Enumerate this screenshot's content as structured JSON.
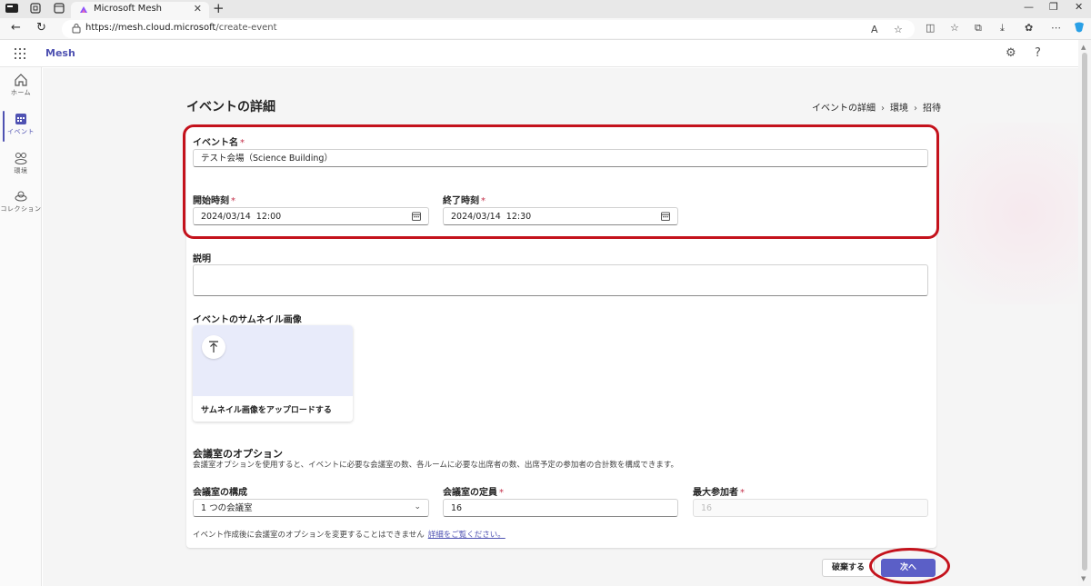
{
  "browser": {
    "tab_title": "Microsoft Mesh",
    "url_host": "https://mesh.cloud.microsoft",
    "url_path": "/create-event"
  },
  "app": {
    "name": "Mesh",
    "accent": "#5b5fc7"
  },
  "rail": {
    "items": [
      {
        "label": "ホーム",
        "icon": "home-icon"
      },
      {
        "label": "イベント",
        "icon": "calendar-icon"
      },
      {
        "label": "環境",
        "icon": "environment-icon"
      },
      {
        "label": "コレクション",
        "icon": "collection-icon"
      }
    ]
  },
  "page": {
    "title": "イベントの詳細",
    "breadcrumb": [
      "イベントの詳細",
      "環境",
      "招待"
    ]
  },
  "form": {
    "event_name_label": "イベント名",
    "event_name_value": "テスト会場（Science Building）",
    "start_label": "開始時刻",
    "start_value": "2024/03/14  12:00",
    "end_label": "終了時刻",
    "end_value": "2024/03/14  12:30",
    "description_label": "説明",
    "thumbnail_label": "イベントのサムネイル画像",
    "thumbnail_upload": "サムネイル画像をアップロードする",
    "room_options_title": "会議室のオプション",
    "room_options_desc": "会議室オプションを使用すると、イベントに必要な会議室の数、各ルームに必要な出席者の数、出席予定の参加者の合計数を構成できます。",
    "room_config_label": "会議室の構成",
    "room_config_value": "1 つの会議室",
    "room_capacity_label": "会議室の定員",
    "room_capacity_value": "16",
    "max_attendees_label": "最大参加者",
    "max_attendees_value": "16",
    "note_text": "イベント作成後に会議室のオプションを変更することはできません",
    "note_link": "詳細をご覧ください。",
    "required_mark": "*"
  },
  "footer": {
    "discard_label": "破棄する",
    "next_label": "次へ"
  }
}
